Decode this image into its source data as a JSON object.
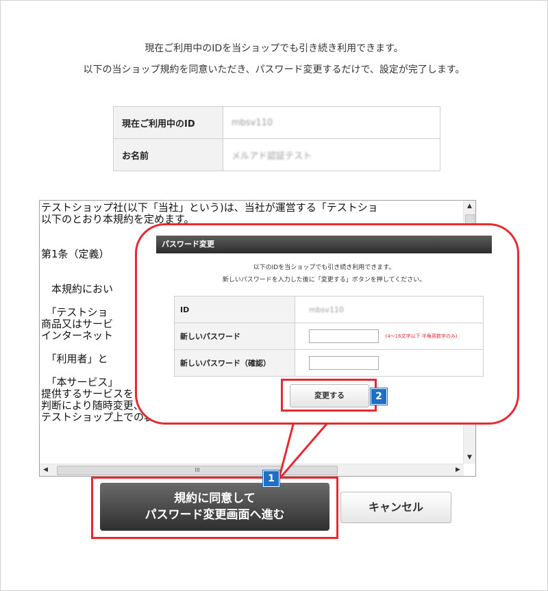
{
  "intro": {
    "line1": "現在ご利用中のIDを当ショップでも引き続き利用できます。",
    "line2": "以下の当ショップ規約を同意いただき、パスワード変更するだけで、設定が完了します。"
  },
  "account_info": {
    "rows": [
      {
        "label": "現在ご利用中のID",
        "value": "mbsv110"
      },
      {
        "label": "お名前",
        "value": "メルアド認証テスト"
      }
    ]
  },
  "terms": {
    "text": "テストショップ社(以下「当社」という)は、当社が運営する「テストショ\n以下のとおり本規約を定めます。\n\n\n第1条（定義）\n\n\n　本規約におい\n\n　「テストショ\n商品又はサービ\nインターネット\n\n　「利用者」と\n\n　「本サービス」\n提供するサービスをいい、サービスの内容、　　　いては、当社の独自\n判断により随時変更、増減が行なわれるもの　　　その通知は随時、\nテストショップ上での表示、又は電子メー　　の他の通信手段を通じて行",
    "hscroll_label": "III"
  },
  "buttons": {
    "agree_line1": "規約に同意して",
    "agree_line2": "パスワード変更画面へ進む",
    "cancel": "キャンセル"
  },
  "dialog": {
    "title": "パスワード変更",
    "line1": "以下のIDを当ショップでも引き続き利用できます。",
    "line2": "新しいパスワードを入力した後に「変更する」ボタンを押してください。",
    "rows": {
      "id_label": "ID",
      "id_value": "mbsv110",
      "new_pw_label": "新しいパスワード",
      "new_pw_hint": "(4〜16文字以下 半角英数字のみ)",
      "confirm_pw_label": "新しいパスワード（確認）"
    },
    "change_button": "変更する"
  },
  "badges": {
    "step1": "1",
    "step2": "2"
  },
  "colors": {
    "highlight": "#e8282e",
    "badge": "#1f6fc4",
    "dark_button": "#3a3a3a"
  }
}
